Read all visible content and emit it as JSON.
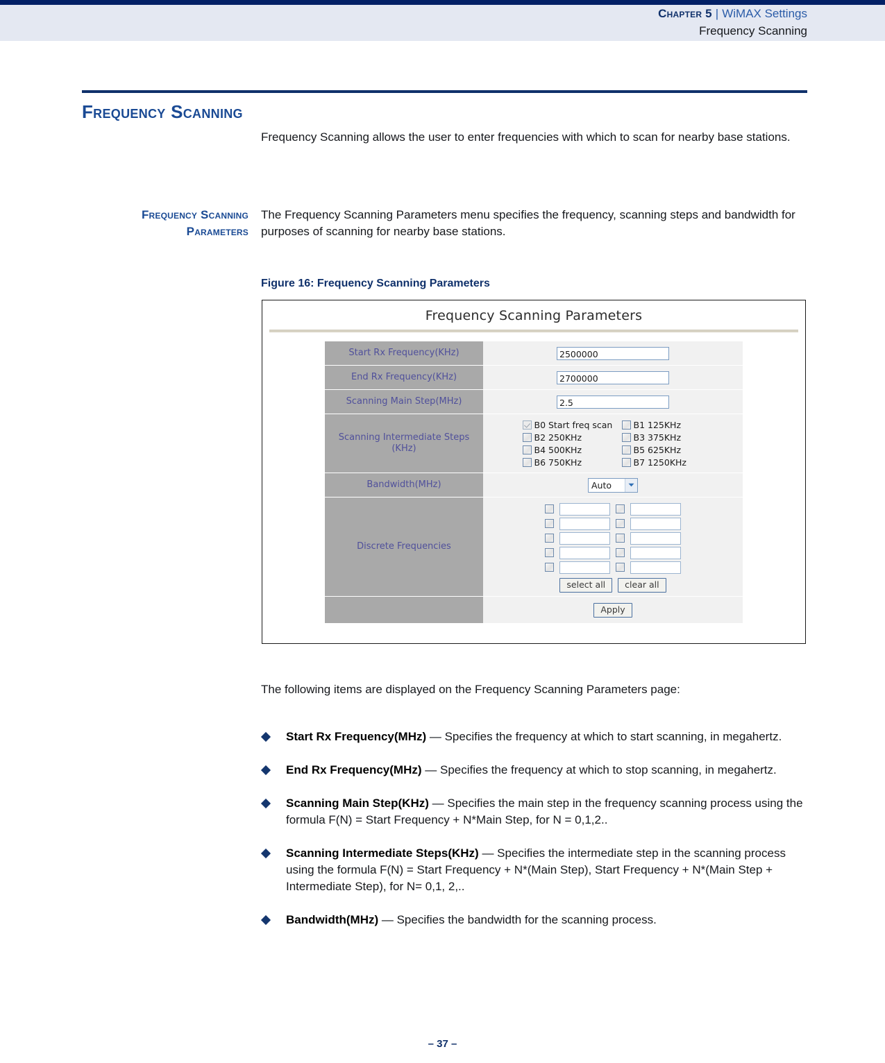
{
  "header": {
    "chapter": "Chapter 5",
    "separator": "|",
    "section": "WiMAX Settings",
    "subsection": "Frequency Scanning"
  },
  "section": {
    "title": "Frequency Scanning",
    "intro": "Frequency Scanning allows the user to enter frequencies with which to scan for nearby base stations."
  },
  "margin_head": "Frequency Scanning Parameters",
  "fsp_para": "The Frequency Scanning Parameters menu specifies the frequency, scanning steps and bandwidth for purposes of scanning for nearby base stations.",
  "figure": {
    "caption": "Figure 16:  Frequency Scanning Parameters",
    "screen_title": "Frequency Scanning Parameters",
    "rows": [
      {
        "label": "Start Rx Frequency(KHz)",
        "value": "2500000"
      },
      {
        "label": "End Rx Frequency(KHz)",
        "value": "2700000"
      },
      {
        "label": "Scanning Main Step(MHz)",
        "value": "2.5"
      }
    ],
    "intermediate": {
      "label_line1": "Scanning Intermediate Steps",
      "label_line2": "(KHz)",
      "options": [
        {
          "label": "B0 Start freq scan",
          "checked": true,
          "disabled": true
        },
        {
          "label": "B1 125KHz",
          "checked": false,
          "disabled": false
        },
        {
          "label": "B2 250KHz",
          "checked": false,
          "disabled": false
        },
        {
          "label": "B3 375KHz",
          "checked": false,
          "disabled": false
        },
        {
          "label": "B4 500KHz",
          "checked": false,
          "disabled": false
        },
        {
          "label": "B5 625KHz",
          "checked": false,
          "disabled": false
        },
        {
          "label": "B6 750KHz",
          "checked": false,
          "disabled": false
        },
        {
          "label": "B7 1250KHz",
          "checked": false,
          "disabled": false
        }
      ]
    },
    "bandwidth": {
      "label": "Bandwidth(MHz)",
      "selected": "Auto"
    },
    "discrete": {
      "label": "Discrete Frequencies",
      "rows": 5,
      "columns": 2,
      "values": [
        [
          "",
          ""
        ],
        [
          "",
          ""
        ],
        [
          "",
          ""
        ],
        [
          "",
          ""
        ],
        [
          "",
          ""
        ]
      ],
      "select_all": "select all",
      "clear_all": "clear all"
    },
    "apply": "Apply"
  },
  "following_para": "The following items are displayed on the Frequency Scanning Parameters page:",
  "bullets": [
    {
      "term": "Start Rx Frequency(MHz)",
      "desc": " — Specifies the frequency at which to start scanning, in megahertz."
    },
    {
      "term": "End Rx Frequency(MHz)",
      "desc": " — Specifies the frequency at which to stop scanning, in megahertz."
    },
    {
      "term": "Scanning Main Step(KHz)",
      "desc": " — Specifies the main step in the frequency scanning process using the formula F(N) = Start Frequency + N*Main Step, for N = 0,1,2.."
    },
    {
      "term": "Scanning Intermediate Steps(KHz)",
      "desc": " — Specifies the intermediate step in the scanning process using the formula F(N) = Start Frequency + N*(Main Step), Start Frequency + N*(Main Step + Intermediate Step), for N= 0,1, 2,.."
    },
    {
      "term": "Bandwidth(MHz)",
      "desc": " — Specifies the bandwidth for the scanning process."
    }
  ],
  "page_number": "–  37  –",
  "colors": {
    "header_bar": "#022066",
    "header_band": "#e4e8f2",
    "heading_blue": "#1a4a94",
    "rule_navy": "#10316b",
    "form_label_bg": "#a9a9a9",
    "form_label_text": "#50509b",
    "form_value_bg": "#f1f1f1",
    "bullet_diamond": "#14366e"
  }
}
